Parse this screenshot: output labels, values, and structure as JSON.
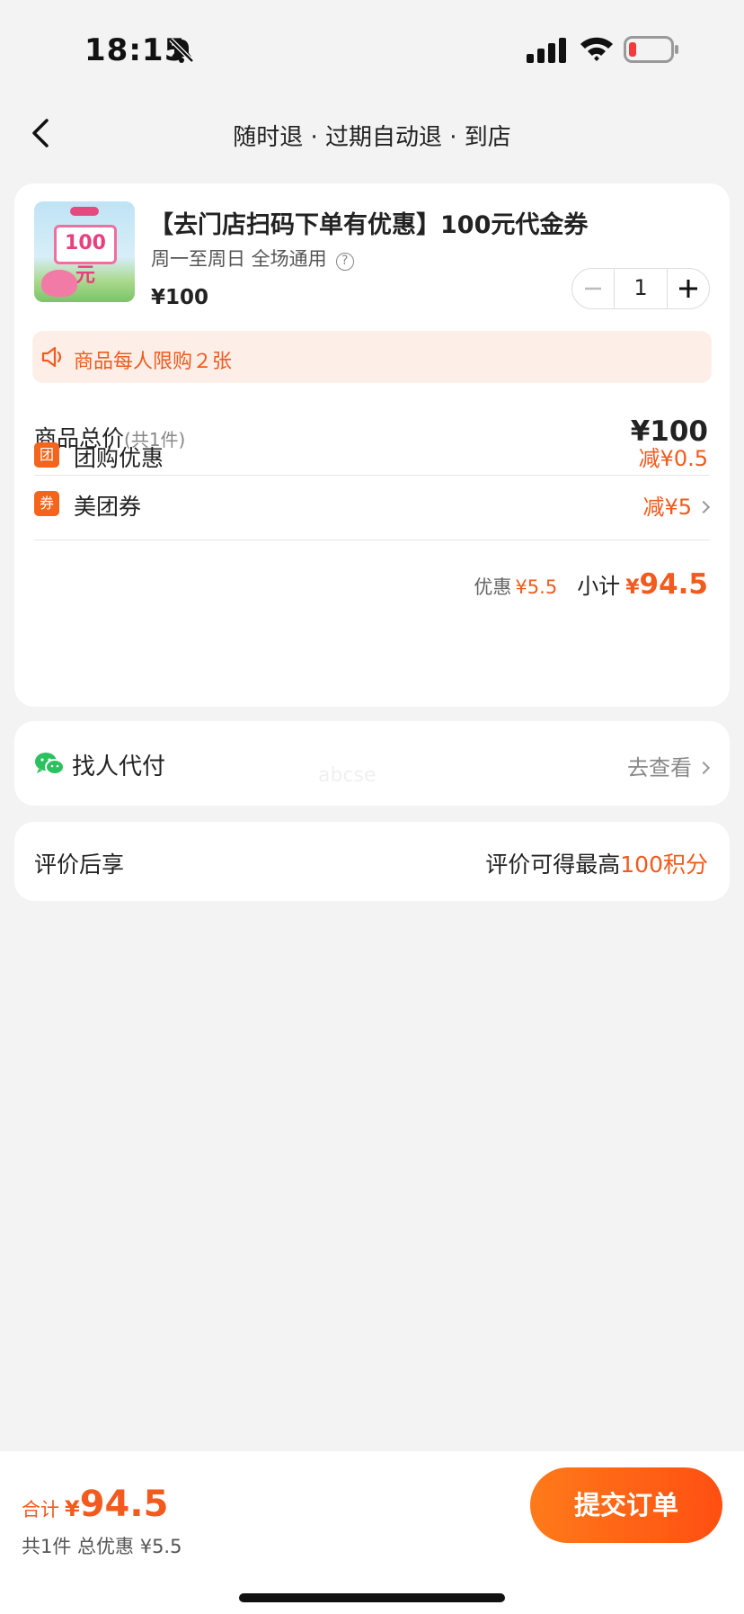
{
  "status_bar": {
    "time": "18:15",
    "icons": [
      "bell-slash-icon",
      "signal-icon",
      "wifi-icon",
      "battery-low-icon"
    ]
  },
  "nav": {
    "title": "随时退 · 过期自动退 · 到店",
    "back_icon": "chevron-left-icon"
  },
  "product": {
    "image_text": "100元",
    "title": "【去门店扫码下单有优惠】100元代金券",
    "subtitle": "周一至周日 全场通用",
    "price": "¥100",
    "quantity": "1",
    "limit_notice": "商品每人限购２张"
  },
  "summary": {
    "total_label": "商品总价",
    "total_count": "(共1件)",
    "total_value": "¥100",
    "discounts": [
      {
        "icon_text": "团",
        "label": "团购优惠",
        "value": "减¥0.5"
      },
      {
        "icon_text": "券",
        "label": "美团券",
        "value": "减¥5"
      }
    ],
    "youhui_label": "优惠",
    "youhui_value": "¥5.5",
    "subtotal_label": "小计",
    "subtotal_currency": "¥",
    "subtotal_value": "94.5"
  },
  "pay_for_me": {
    "label": "找人代付",
    "action": "去查看",
    "watermark": "abcse"
  },
  "review": {
    "label": "评价后享",
    "prefix": "评价可得最高",
    "points": "100积分"
  },
  "bottom_bar": {
    "total_label": "合计",
    "currency": "¥",
    "amount": "94.5",
    "detail": "共1件  总优惠 ¥5.5",
    "submit_label": "提交订单"
  },
  "colors": {
    "accent": "#f25a1e",
    "button_start": "#ff7a1a",
    "button_end": "#ff4f12",
    "background": "#f3f3f3",
    "wechat": "#2bc15f"
  }
}
